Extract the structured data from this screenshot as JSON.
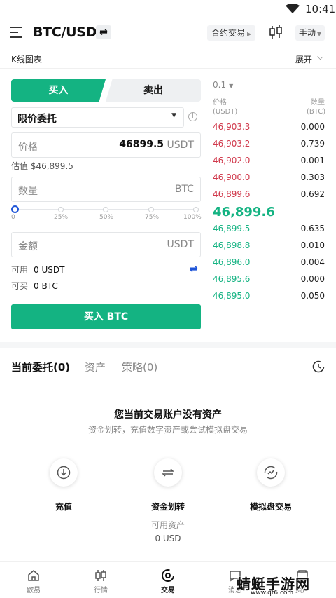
{
  "status_bar": {
    "time": "10:41"
  },
  "header": {
    "pair": "BTC/USDT",
    "swap_glyph": "⇌",
    "contract_label": "合约交易",
    "manual_label": "手动"
  },
  "kline": {
    "label": "K线图表",
    "expand_label": "展开"
  },
  "trade": {
    "buy_tab": "买入",
    "sell_tab": "卖出",
    "order_type": "限价委托",
    "price_placeholder": "价格",
    "price_value": "46899.5",
    "price_unit": "USDT",
    "estimate": "估值 $46,899.5",
    "qty_placeholder": "数量",
    "qty_unit": "BTC",
    "slider_ticks": [
      "0",
      "25%",
      "50%",
      "75%",
      "100%"
    ],
    "slider_level": 0,
    "amount_placeholder": "金额",
    "amount_unit": "USDT",
    "available_label": "可用",
    "available_value": "0 USDT",
    "can_buy_label": "可买",
    "can_buy_value": "0 BTC",
    "buy_button": "买入 BTC"
  },
  "orderbook": {
    "precision": "0.1",
    "price_header": "价格",
    "price_unit": "(USDT)",
    "qty_header": "数量",
    "qty_unit": "(BTC)",
    "asks": [
      {
        "price": "46,903.3",
        "qty": "0.000"
      },
      {
        "price": "46,903.2",
        "qty": "0.739"
      },
      {
        "price": "46,902.0",
        "qty": "0.001"
      },
      {
        "price": "46,900.0",
        "qty": "0.303"
      },
      {
        "price": "46,899.6",
        "qty": "0.692"
      }
    ],
    "mid_price": "46,899.6",
    "bids": [
      {
        "price": "46,899.5",
        "qty": "0.635"
      },
      {
        "price": "46,898.8",
        "qty": "0.010"
      },
      {
        "price": "46,896.0",
        "qty": "0.004"
      },
      {
        "price": "46,895.6",
        "qty": "0.000"
      },
      {
        "price": "46,895.0",
        "qty": "0.050"
      }
    ],
    "ask_color": "#d0374a",
    "bid_color": "#14b382"
  },
  "bottom_tabs": {
    "orders": "当前委托(0)",
    "assets": "资产",
    "strategy": "策略(0)"
  },
  "empty": {
    "title": "您当前交易账户没有资产",
    "subtitle": "资金划转，充值数字资产或尝试模拟盘交易"
  },
  "actions": [
    {
      "label": "充值",
      "icon": "deposit-icon"
    },
    {
      "label": "资金划转",
      "icon": "transfer-icon"
    },
    {
      "label": "模拟盘交易",
      "icon": "demo-trade-icon"
    }
  ],
  "assets": {
    "label": "可用资产",
    "value": "0 USD"
  },
  "nav": [
    {
      "label": "欧易",
      "icon": "home-icon"
    },
    {
      "label": "行情",
      "icon": "market-icon"
    },
    {
      "label": "交易",
      "icon": "trade-icon"
    },
    {
      "label": "消息",
      "icon": "message-icon"
    },
    {
      "label": "资产",
      "icon": "wallet-icon"
    }
  ],
  "watermark": {
    "brand": "蜻蜓手游网",
    "url": "www.qt6.com"
  },
  "colors": {
    "accent": "#14b382",
    "blue": "#1f55d8"
  }
}
